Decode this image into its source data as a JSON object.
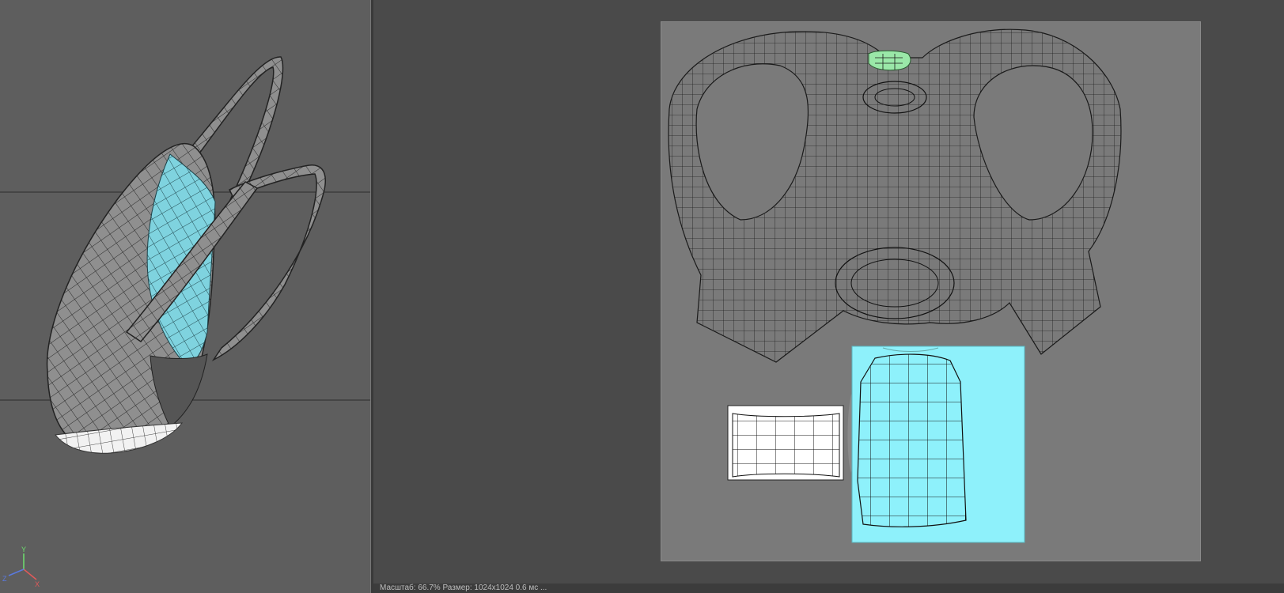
{
  "viewport": {
    "axis_labels": {
      "y": "Y",
      "x": "X",
      "z": "Z"
    },
    "colors": {
      "background": "#5e5e5e",
      "mesh_gray": "#8d8d8d",
      "mesh_selected": "#7fd3df",
      "mesh_white": "#f2f2f2",
      "wire": "#2a2a2a"
    }
  },
  "uv_editor": {
    "colors": {
      "page": "#7a7a7a",
      "island_selected": "#8ef1fb",
      "island_green": "#9ae8a8",
      "island_white": "#ffffff",
      "wire": "#1e1e1e"
    }
  },
  "status_bar": {
    "text": "Масштаб: 66.7%  Размер: 1024x1024  0.6 мс  ..."
  }
}
